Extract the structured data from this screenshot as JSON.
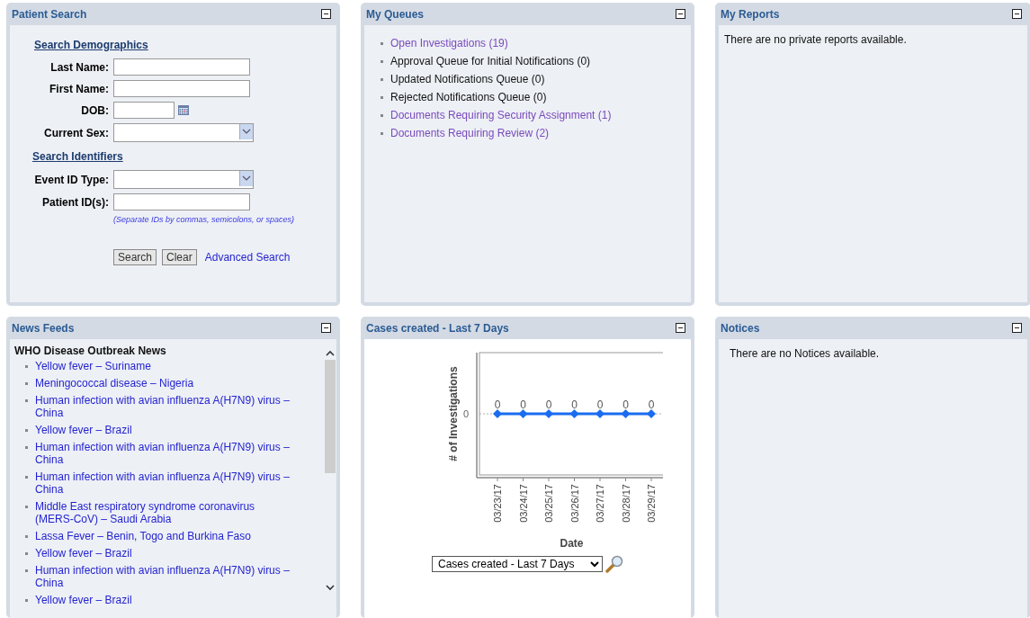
{
  "panels": [
    {
      "kind": "search",
      "title": "Patient Search",
      "sections": [
        {
          "heading": "Search Demographics",
          "fields": [
            {
              "label": "Last Name:",
              "kind": "text"
            },
            {
              "label": "First Name:",
              "kind": "text"
            },
            {
              "label": "DOB:",
              "kind": "date"
            },
            {
              "label": "Current Sex:",
              "kind": "select"
            }
          ]
        },
        {
          "heading": "Search Identifiers",
          "fields": [
            {
              "label": "Event ID Type:",
              "kind": "select"
            },
            {
              "label": "Patient ID(s):",
              "kind": "text",
              "hint": "(Separate IDs by commas, semicolons, or spaces)"
            }
          ]
        }
      ],
      "buttons": [
        "Search",
        "Clear"
      ],
      "link": "Advanced Search"
    },
    {
      "kind": "queues",
      "title": "My Queues",
      "items": [
        {
          "label": "Open Investigations (19)",
          "kind": "link"
        },
        {
          "label": "Approval Queue for Initial Notifications (0)",
          "kind": "text"
        },
        {
          "label": "Updated Notifications Queue (0)",
          "kind": "text"
        },
        {
          "label": "Rejected Notifications Queue (0)",
          "kind": "text"
        },
        {
          "label": "Documents Requiring Security Assignment (1)",
          "kind": "link"
        },
        {
          "label": "Documents Requiring Review (2)",
          "kind": "link"
        }
      ]
    },
    {
      "kind": "message",
      "title": "My Reports",
      "message": "There are no private reports available."
    },
    {
      "kind": "news",
      "title": "News Feeds",
      "feed": "WHO Disease Outbreak News",
      "items": [
        "Yellow fever – Suriname",
        "Meningococcal disease – Nigeria",
        "Human infection with avian influenza A(H7N9) virus – China",
        "Yellow fever – Brazil",
        "Human infection with avian influenza A(H7N9) virus – China",
        "Human infection with avian influenza A(H7N9) virus – China",
        "Middle East respiratory syndrome coronavirus (MERS-CoV) – Saudi Arabia",
        "Lassa Fever – Benin, Togo and Burkina Faso",
        "Yellow fever – Brazil",
        "Human infection with avian influenza A(H7N9) virus – China",
        "Yellow fever – Brazil"
      ]
    },
    {
      "kind": "chart",
      "title": "Cases created - Last 7 Days",
      "select": "Cases created - Last 7 Days",
      "chart": {
        "xlabel": "Date",
        "ylabel": "# of Investigations",
        "y_tick": "0",
        "dates": [
          "03/23/17",
          "03/24/17",
          "03/25/17",
          "03/26/17",
          "03/27/17",
          "03/28/17",
          "03/29/17"
        ],
        "point_labels": [
          "0",
          "0",
          "0",
          "0",
          "0",
          "0",
          "0"
        ]
      }
    },
    {
      "kind": "message",
      "title": "Notices",
      "message": "There are no Notices available."
    }
  ]
}
